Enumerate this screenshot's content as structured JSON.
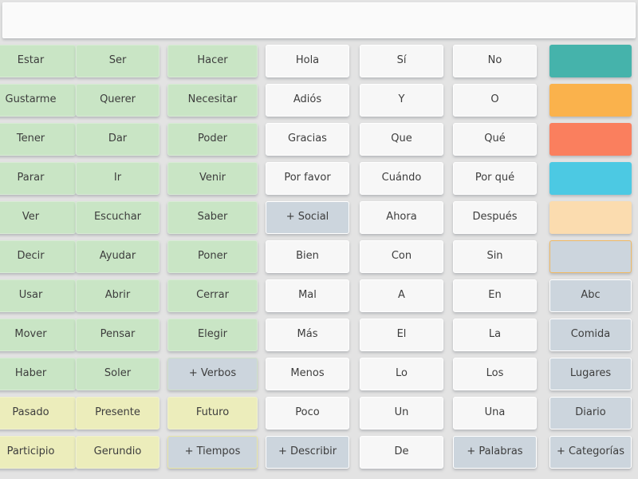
{
  "app": {
    "name": "aac-communication-grid",
    "language": "es"
  },
  "message_bar": {
    "value": "",
    "placeholder": ""
  },
  "layout": {
    "columns": 7,
    "rows": 11,
    "first_column_clipped_left": true
  },
  "colors": {
    "background": "#e3e3e3",
    "verb_green": "#c9e5c5",
    "tense_yellow": "#ecedbb",
    "word_white": "#f7f7f7",
    "navigation_gray": "#ccd5dd",
    "speak_teal": "#45b3ab",
    "backspace_orange": "#fab24c",
    "clear_red": "#fa7f5e",
    "play_cyan": "#4cc9e3",
    "addpage_peach": "#fbdcaf",
    "page_gray": "#ccd5dd",
    "text": "#3d3d3d"
  },
  "columns": [
    {
      "name": "verbs-column-1",
      "cells": [
        {
          "label": "Estar",
          "style": "green",
          "kind": "word"
        },
        {
          "label": "Gustarme",
          "style": "green",
          "kind": "word"
        },
        {
          "label": "Tener",
          "style": "green",
          "kind": "word"
        },
        {
          "label": "Parar",
          "style": "green",
          "kind": "word"
        },
        {
          "label": "Ver",
          "style": "green",
          "kind": "word"
        },
        {
          "label": "Decir",
          "style": "green",
          "kind": "word"
        },
        {
          "label": "Usar",
          "style": "green",
          "kind": "word"
        },
        {
          "label": "Mover",
          "style": "green",
          "kind": "word"
        },
        {
          "label": "Haber",
          "style": "green",
          "kind": "word"
        },
        {
          "label": "Pasado",
          "style": "yellow",
          "kind": "word"
        },
        {
          "label": "Participio",
          "style": "yellow",
          "kind": "word"
        }
      ]
    },
    {
      "name": "verbs-column-2",
      "cells": [
        {
          "label": "Ser",
          "style": "green",
          "kind": "word"
        },
        {
          "label": "Querer",
          "style": "green",
          "kind": "word"
        },
        {
          "label": "Dar",
          "style": "green",
          "kind": "word"
        },
        {
          "label": "Ir",
          "style": "green",
          "kind": "word"
        },
        {
          "label": "Escuchar",
          "style": "green",
          "kind": "word"
        },
        {
          "label": "Ayudar",
          "style": "green",
          "kind": "word"
        },
        {
          "label": "Abrir",
          "style": "green",
          "kind": "word"
        },
        {
          "label": "Pensar",
          "style": "green",
          "kind": "word"
        },
        {
          "label": "Soler",
          "style": "green",
          "kind": "word"
        },
        {
          "label": "Presente",
          "style": "yellow",
          "kind": "word"
        },
        {
          "label": "Gerundio",
          "style": "yellow",
          "kind": "word"
        }
      ]
    },
    {
      "name": "verbs-column-3",
      "cells": [
        {
          "label": "Hacer",
          "style": "green",
          "kind": "word"
        },
        {
          "label": "Necesitar",
          "style": "green",
          "kind": "word"
        },
        {
          "label": "Poder",
          "style": "green",
          "kind": "word"
        },
        {
          "label": "Venir",
          "style": "green",
          "kind": "word"
        },
        {
          "label": "Saber",
          "style": "green",
          "kind": "word"
        },
        {
          "label": "Poner",
          "style": "green",
          "kind": "word"
        },
        {
          "label": "Cerrar",
          "style": "green",
          "kind": "word"
        },
        {
          "label": "Elegir",
          "style": "green",
          "kind": "word"
        },
        {
          "label": "+ Verbos",
          "style": "nav-green",
          "kind": "nav"
        },
        {
          "label": "Futuro",
          "style": "yellow",
          "kind": "word"
        },
        {
          "label": "+ Tiempos",
          "style": "nav-yellow",
          "kind": "nav"
        }
      ]
    },
    {
      "name": "social-column-4",
      "cells": [
        {
          "label": "Hola",
          "style": "white",
          "kind": "word"
        },
        {
          "label": "Adiós",
          "style": "white",
          "kind": "word"
        },
        {
          "label": "Gracias",
          "style": "white",
          "kind": "word"
        },
        {
          "label": "Por favor",
          "style": "white",
          "kind": "word"
        },
        {
          "label": "+ Social",
          "style": "nav",
          "kind": "nav"
        },
        {
          "label": "Bien",
          "style": "white",
          "kind": "word"
        },
        {
          "label": "Mal",
          "style": "white",
          "kind": "word"
        },
        {
          "label": "Más",
          "style": "white",
          "kind": "word"
        },
        {
          "label": "Menos",
          "style": "white",
          "kind": "word"
        },
        {
          "label": "Poco",
          "style": "white",
          "kind": "word"
        },
        {
          "label": "+ Describir",
          "style": "nav",
          "kind": "nav"
        }
      ]
    },
    {
      "name": "words-column-5",
      "cells": [
        {
          "label": "Sí",
          "style": "white",
          "kind": "word"
        },
        {
          "label": "Y",
          "style": "white",
          "kind": "word"
        },
        {
          "label": "Que",
          "style": "white",
          "kind": "word"
        },
        {
          "label": "Cuándo",
          "style": "white",
          "kind": "word"
        },
        {
          "label": "Ahora",
          "style": "white",
          "kind": "word"
        },
        {
          "label": "Con",
          "style": "white",
          "kind": "word"
        },
        {
          "label": "A",
          "style": "white",
          "kind": "word"
        },
        {
          "label": "El",
          "style": "white",
          "kind": "word"
        },
        {
          "label": "Lo",
          "style": "white",
          "kind": "word"
        },
        {
          "label": "Un",
          "style": "white",
          "kind": "word"
        },
        {
          "label": "De",
          "style": "white",
          "kind": "word"
        }
      ]
    },
    {
      "name": "words-column-6",
      "cells": [
        {
          "label": "No",
          "style": "white",
          "kind": "word"
        },
        {
          "label": "O",
          "style": "white",
          "kind": "word"
        },
        {
          "label": "Qué",
          "style": "white",
          "kind": "word"
        },
        {
          "label": "Por qué",
          "style": "white",
          "kind": "word"
        },
        {
          "label": "Después",
          "style": "white",
          "kind": "word"
        },
        {
          "label": "Sin",
          "style": "white",
          "kind": "word"
        },
        {
          "label": "En",
          "style": "white",
          "kind": "word"
        },
        {
          "label": "La",
          "style": "white",
          "kind": "word"
        },
        {
          "label": "Los",
          "style": "white",
          "kind": "word"
        },
        {
          "label": "Una",
          "style": "white",
          "kind": "word"
        },
        {
          "label": "+ Palabras",
          "style": "nav",
          "kind": "nav"
        }
      ]
    },
    {
      "name": "actions-column-7",
      "cells": [
        {
          "label": "",
          "style": "teal",
          "kind": "action",
          "icon": "speak-play-circle-icon"
        },
        {
          "label": "",
          "style": "orange",
          "kind": "action",
          "icon": "backspace-icon"
        },
        {
          "label": "",
          "style": "red",
          "kind": "action",
          "icon": "clear-close-icon"
        },
        {
          "label": "",
          "style": "cyan",
          "kind": "action",
          "icon": "play-triangle-icon"
        },
        {
          "label": "",
          "style": "peach",
          "kind": "action",
          "icon": "add-page-icon"
        },
        {
          "label": "",
          "style": "page",
          "kind": "action",
          "icon": "page-icon"
        },
        {
          "label": "Abc",
          "style": "nav",
          "kind": "nav"
        },
        {
          "label": "Comida",
          "style": "nav",
          "kind": "nav"
        },
        {
          "label": "Lugares",
          "style": "nav",
          "kind": "nav"
        },
        {
          "label": "Diario",
          "style": "nav",
          "kind": "nav"
        },
        {
          "label": "+ Categorías",
          "style": "nav",
          "kind": "nav"
        }
      ]
    }
  ]
}
